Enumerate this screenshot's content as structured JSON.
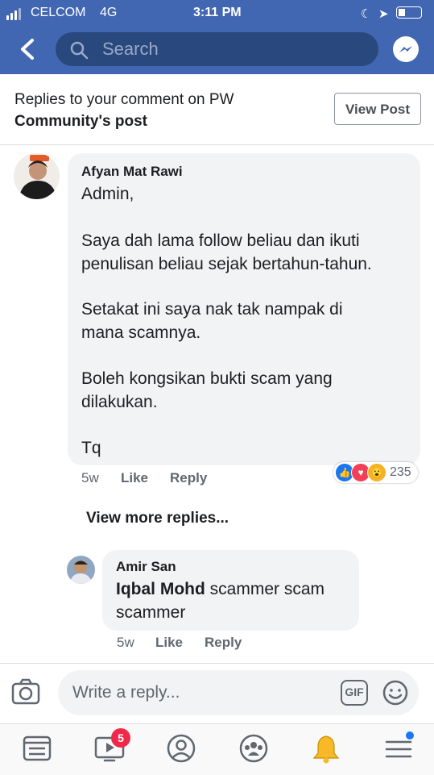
{
  "status_bar": {
    "carrier": "CELCOM",
    "network": "4G",
    "time": "3:11 PM"
  },
  "header": {
    "search_placeholder": "Search",
    "icons": [
      "back-arrow-icon",
      "search-icon",
      "messenger-icon"
    ]
  },
  "notice": {
    "line1": "Replies to your comment on PW",
    "line2": "Community's post",
    "view_post_label": "View Post"
  },
  "comment": {
    "author": "Afyan Mat Rawi",
    "paragraphs": [
      "Admin,",
      "Saya dah lama follow beliau dan ikuti",
      "penulisan beliau sejak bertahun-tahun.",
      "Setakat ini saya nak tak nampak di",
      "mana scamnya.",
      "Boleh kongsikan bukti scam yang",
      "dilakukan.",
      "Tq"
    ],
    "time": "5w",
    "like_label": "Like",
    "reply_label": "Reply",
    "reaction_count": "235",
    "reactions": [
      "like-icon",
      "love-icon",
      "wow-icon"
    ]
  },
  "view_more_label": "View more replies...",
  "reply": {
    "author": "Amir San",
    "mention": "Iqbal Mohd",
    "text_line1": " scammer scam",
    "text_line2": "scammer",
    "time": "5w",
    "like_label": "Like",
    "reply_label": "Reply"
  },
  "composer": {
    "placeholder": "Write a reply...",
    "gif_label": "GIF"
  },
  "bottom_nav": {
    "video_badge": "5",
    "items": [
      "news-feed-icon",
      "watch-icon",
      "profile-icon",
      "groups-icon",
      "notifications-icon",
      "menu-icon"
    ]
  },
  "colors": {
    "brand": "#4267b2",
    "search_bg": "#29487d",
    "bubble": "#f2f3f5",
    "badge": "#f02849"
  }
}
